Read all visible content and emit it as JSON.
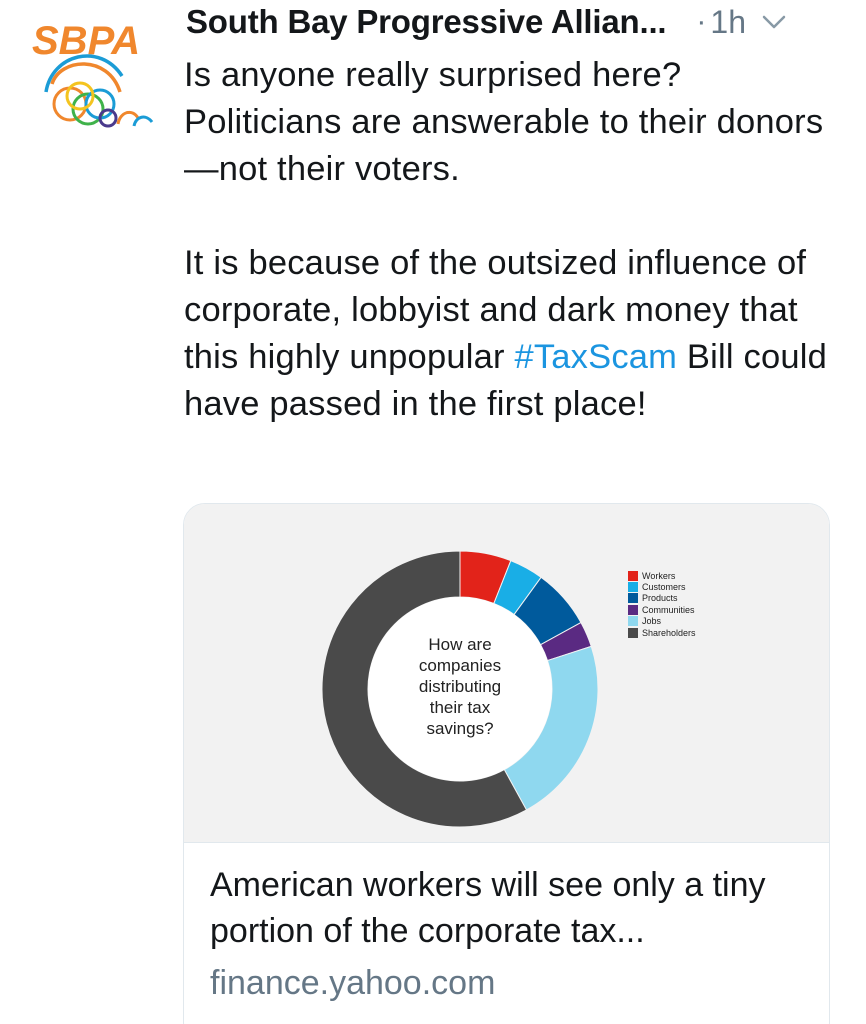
{
  "header": {
    "account_name": "South Bay Progressive Allian...",
    "separator": "·",
    "time": "1h"
  },
  "avatar": {
    "logo_text": "SBPA",
    "logo_color": "#f0872d"
  },
  "tweet": {
    "paragraph1": "Is anyone really surprised here? Politicians are answerable to their donors—not their voters.",
    "paragraph2_before": "It is because of the outsized influence of corporate, lobbyist and dark money that this highly unpopular ",
    "hashtag": "#TaxScam",
    "paragraph2_after": " Bill could have passed in the first place!",
    "hashtag_color": "#1b95e0"
  },
  "card": {
    "title": "American workers will see only a tiny portion of the corporate tax...",
    "domain": "finance.yahoo.com",
    "chart_center_text": [
      "How are",
      "companies",
      "distributing",
      "their tax",
      "savings?"
    ]
  },
  "chart_data": {
    "type": "pie",
    "title": "How are companies distributing their tax savings?",
    "categories": [
      "Workers",
      "Customers",
      "Products",
      "Communities",
      "Jobs",
      "Shareholders"
    ],
    "values": [
      6,
      4,
      7,
      3,
      22,
      58
    ],
    "colors": [
      "#e2231a",
      "#19aee6",
      "#005a9c",
      "#5a2a82",
      "#8fd8ef",
      "#4a4a4a"
    ],
    "legend_position": "top-right",
    "donut": true
  }
}
